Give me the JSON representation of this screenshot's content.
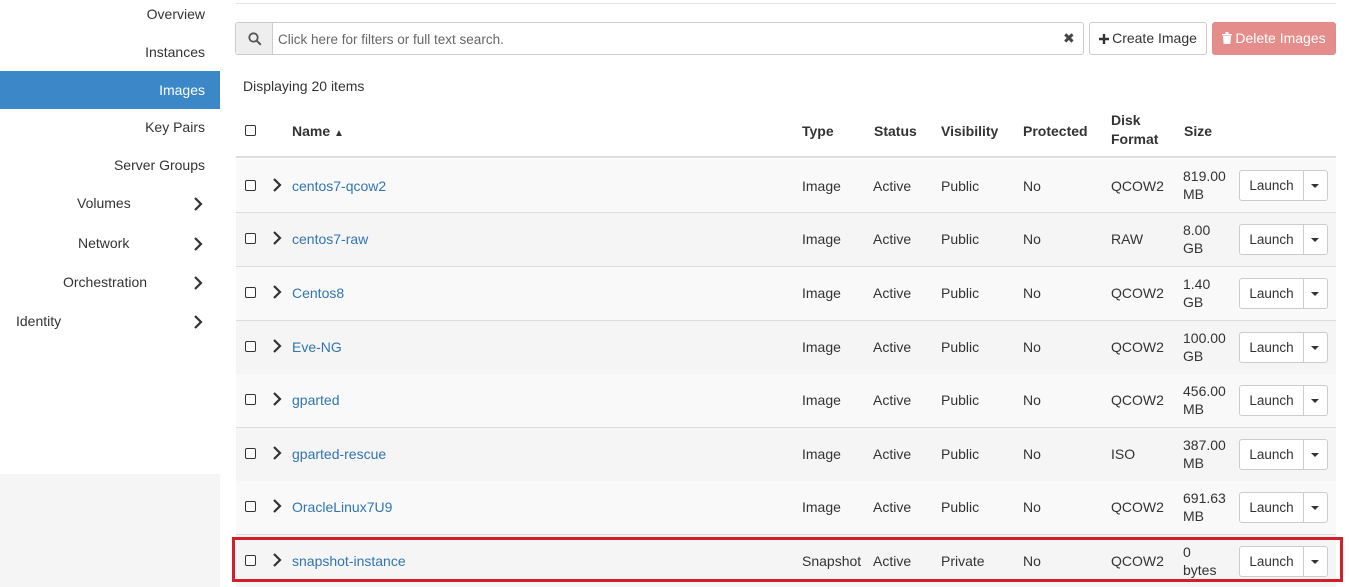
{
  "sidebar": {
    "overview": "Overview",
    "instances": "Instances",
    "images": "Images",
    "key_pairs": "Key Pairs",
    "server_groups": "Server Groups",
    "volumes": "Volumes",
    "network": "Network",
    "orchestration": "Orchestration",
    "identity": "Identity"
  },
  "search": {
    "placeholder": "Click here for filters or full text search.",
    "clear_glyph": "✖"
  },
  "actions": {
    "create_image": "Create Image",
    "delete_images": "Delete Images"
  },
  "table": {
    "displaying": "Displaying 20 items",
    "headers": {
      "name": "Name",
      "type": "Type",
      "status": "Status",
      "visibility": "Visibility",
      "protected": "Protected",
      "disk_format_1": "Disk",
      "disk_format_2": "Format",
      "size": "Size"
    },
    "sort_indicator": "▲",
    "launch_label": "Launch",
    "rows": [
      {
        "name": "centos7-qcow2",
        "type": "Image",
        "status": "Active",
        "visibility": "Public",
        "protected": "No",
        "format": "QCOW2",
        "size_1": "819.00",
        "size_2": "MB"
      },
      {
        "name": "centos7-raw",
        "type": "Image",
        "status": "Active",
        "visibility": "Public",
        "protected": "No",
        "format": "RAW",
        "size_1": "8.00",
        "size_2": "GB"
      },
      {
        "name": "Centos8",
        "type": "Image",
        "status": "Active",
        "visibility": "Public",
        "protected": "No",
        "format": "QCOW2",
        "size_1": "1.40",
        "size_2": "GB"
      },
      {
        "name": "Eve-NG",
        "type": "Image",
        "status": "Active",
        "visibility": "Public",
        "protected": "No",
        "format": "QCOW2",
        "size_1": "100.00",
        "size_2": "GB"
      },
      {
        "name": "gparted",
        "type": "Image",
        "status": "Active",
        "visibility": "Public",
        "protected": "No",
        "format": "QCOW2",
        "size_1": "456.00",
        "size_2": "MB"
      },
      {
        "name": "gparted-rescue",
        "type": "Image",
        "status": "Active",
        "visibility": "Public",
        "protected": "No",
        "format": "ISO",
        "size_1": "387.00",
        "size_2": "MB"
      },
      {
        "name": "OracleLinux7U9",
        "type": "Image",
        "status": "Active",
        "visibility": "Public",
        "protected": "No",
        "format": "QCOW2",
        "size_1": "691.63",
        "size_2": "MB"
      },
      {
        "name": "snapshot-instance",
        "type": "Snapshot",
        "status": "Active",
        "visibility": "Private",
        "protected": "No",
        "format": "QCOW2",
        "size_1": "0",
        "size_2": "bytes"
      }
    ]
  },
  "colors": {
    "accent": "#3b87c8",
    "link": "#3175b0",
    "danger": "#e48d8a",
    "highlight": "#d21f2a"
  }
}
